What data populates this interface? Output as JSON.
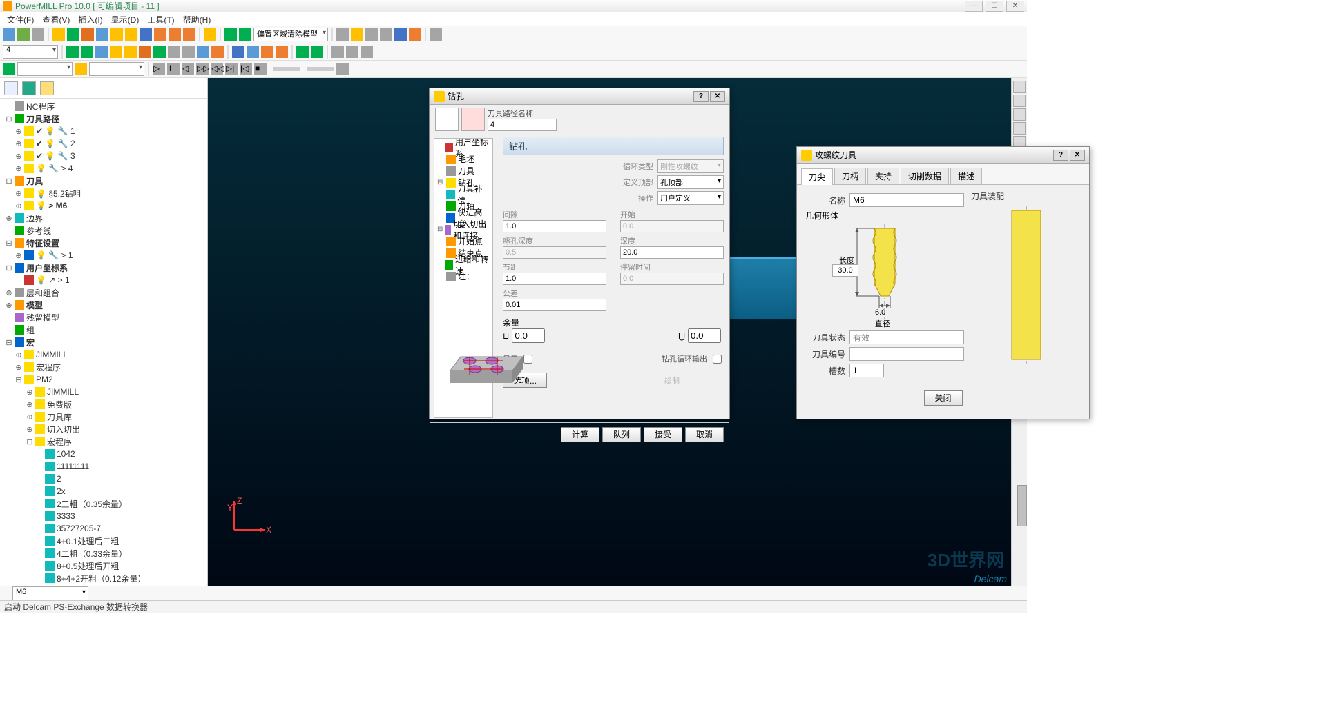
{
  "titlebar": {
    "title": "PowerMILL Pro 10.0     [ 可编辑项目 - 11 ]"
  },
  "menu": [
    "文件(F)",
    "查看(V)",
    "插入(I)",
    "显示(D)",
    "工具(T)",
    "帮助(H)"
  ],
  "toolbar1_combo": "偏置区域清除模型",
  "toolbar2_num": "4",
  "tree": {
    "items": [
      {
        "ind": 0,
        "exp": "",
        "icon": "ic-gray",
        "label": "NC程序"
      },
      {
        "ind": 0,
        "exp": "⊟",
        "icon": "ic-green",
        "label": "刀具路径",
        "bold": true
      },
      {
        "ind": 1,
        "exp": "⊕",
        "icon": "ic-yellow",
        "label": "1",
        "prefix": "✔ 💡 🔧 "
      },
      {
        "ind": 1,
        "exp": "⊕",
        "icon": "ic-yellow",
        "label": "2",
        "prefix": "✔ 💡 🔧 "
      },
      {
        "ind": 1,
        "exp": "⊕",
        "icon": "ic-yellow",
        "label": "3",
        "prefix": "✔ 💡 🔧 "
      },
      {
        "ind": 1,
        "exp": "⊕",
        "icon": "ic-yellow",
        "label": "> 4",
        "prefix": "  💡 🔧 "
      },
      {
        "ind": 0,
        "exp": "⊟",
        "icon": "ic-orange",
        "label": "刀具",
        "bold": true
      },
      {
        "ind": 1,
        "exp": "⊕",
        "icon": "ic-yellow",
        "label": "§5.2钻咀",
        "prefix": "  💡 "
      },
      {
        "ind": 1,
        "exp": "⊕",
        "icon": "ic-yellow",
        "label": "> M6",
        "prefix": "  💡 ",
        "bold": true
      },
      {
        "ind": 0,
        "exp": "⊕",
        "icon": "ic-teal",
        "label": "边界"
      },
      {
        "ind": 0,
        "exp": "",
        "icon": "ic-green",
        "label": "参考线"
      },
      {
        "ind": 0,
        "exp": "⊟",
        "icon": "ic-orange",
        "label": "特征设置",
        "bold": true
      },
      {
        "ind": 1,
        "exp": "⊕",
        "icon": "ic-blue",
        "label": "> 1",
        "prefix": "  💡 🔧 "
      },
      {
        "ind": 0,
        "exp": "⊟",
        "icon": "ic-blue",
        "label": "用户坐标系",
        "bold": true
      },
      {
        "ind": 1,
        "exp": "",
        "icon": "ic-red",
        "label": "> 1",
        "prefix": "  💡 ↗ "
      },
      {
        "ind": 0,
        "exp": "⊕",
        "icon": "ic-gray",
        "label": "层和组合"
      },
      {
        "ind": 0,
        "exp": "⊕",
        "icon": "ic-orange",
        "label": "模型",
        "bold": true
      },
      {
        "ind": 0,
        "exp": "",
        "icon": "ic-purple",
        "label": "残留模型"
      },
      {
        "ind": 0,
        "exp": "",
        "icon": "ic-green",
        "label": "组"
      },
      {
        "ind": 0,
        "exp": "⊟",
        "icon": "ic-blue",
        "label": "宏",
        "bold": true
      },
      {
        "ind": 1,
        "exp": "⊕",
        "icon": "ic-yellow",
        "label": "JIMMILL"
      },
      {
        "ind": 1,
        "exp": "⊕",
        "icon": "ic-yellow",
        "label": "宏程序"
      },
      {
        "ind": 1,
        "exp": "⊟",
        "icon": "ic-yellow",
        "label": "PM2"
      },
      {
        "ind": 2,
        "exp": "⊕",
        "icon": "ic-yellow",
        "label": "JIMMILL"
      },
      {
        "ind": 2,
        "exp": "⊕",
        "icon": "ic-yellow",
        "label": "免费版"
      },
      {
        "ind": 2,
        "exp": "⊕",
        "icon": "ic-yellow",
        "label": "刀具库"
      },
      {
        "ind": 2,
        "exp": "⊕",
        "icon": "ic-yellow",
        "label": "切入切出"
      },
      {
        "ind": 2,
        "exp": "⊟",
        "icon": "ic-yellow",
        "label": "宏程序"
      },
      {
        "ind": 3,
        "exp": "",
        "icon": "ic-teal",
        "label": "1042"
      },
      {
        "ind": 3,
        "exp": "",
        "icon": "ic-teal",
        "label": "11111111"
      },
      {
        "ind": 3,
        "exp": "",
        "icon": "ic-teal",
        "label": "2"
      },
      {
        "ind": 3,
        "exp": "",
        "icon": "ic-teal",
        "label": "2x"
      },
      {
        "ind": 3,
        "exp": "",
        "icon": "ic-teal",
        "label": "2三粗（0.35余量）"
      },
      {
        "ind": 3,
        "exp": "",
        "icon": "ic-teal",
        "label": "3333"
      },
      {
        "ind": 3,
        "exp": "",
        "icon": "ic-teal",
        "label": "35727205-7"
      },
      {
        "ind": 3,
        "exp": "",
        "icon": "ic-teal",
        "label": "4+0.1处理后二粗"
      },
      {
        "ind": 3,
        "exp": "",
        "icon": "ic-teal",
        "label": "4二粗（0.33余量）"
      },
      {
        "ind": 3,
        "exp": "",
        "icon": "ic-teal",
        "label": "8+0.5处理后开粗"
      },
      {
        "ind": 3,
        "exp": "",
        "icon": "ic-teal",
        "label": "8+4+2开粗（0.12余量）"
      }
    ]
  },
  "bottom_combo": "M6",
  "status": "启动 Delcam PS-Exchange 数据转换器",
  "delcam": "Delcam",
  "watermark": "3D世界网",
  "drill": {
    "title": "钻孔",
    "path_name_label": "刀具路径名称",
    "path_name_value": "4",
    "section_title": "钻孔",
    "tree": [
      "用户坐标系",
      "毛坯",
      "刀具",
      "钻孔",
      "刀具补偿",
      "刀轴",
      "快进高度",
      "切入切出和连接",
      "开始点",
      "结束点",
      "进给和转速",
      "注："
    ],
    "p": {
      "cycle_type_lbl": "循环类型",
      "cycle_type_val": "刚性攻螺纹",
      "def_top_lbl": "定义顶部",
      "def_top_val": "孔顶部",
      "op_lbl": "操作",
      "op_val": "用户定义",
      "gap_lbl": "间隙",
      "gap_val": "1.0",
      "start_lbl": "开始",
      "start_val": "0.0",
      "peck_lbl": "啄孔深度",
      "peck_val": "0.5",
      "depth_lbl": "深度",
      "depth_val": "20.0",
      "pitch_lbl": "节距",
      "pitch_val": "1.0",
      "dwell_lbl": "停留时间",
      "dwell_val": "0.0",
      "tol_lbl": "公差",
      "tol_val": "0.01",
      "allow_lbl": "余量",
      "allow_val": "0.0",
      "allow_val2": "0.0",
      "show_lbl": "显示",
      "cycle_out_lbl": "钻孔循环输出",
      "draw_lbl": "绘制",
      "options_btn": "选项..."
    },
    "footer": {
      "calc": "计算",
      "queue": "队列",
      "accept": "接受",
      "cancel": "取消"
    }
  },
  "tool": {
    "title": "攻螺纹刀具",
    "tabs": [
      "刀尖",
      "刀柄",
      "夹持",
      "切削数据",
      "描述"
    ],
    "name_lbl": "名称",
    "name_val": "M6",
    "geo_lbl": "几何形体",
    "len_lbl": "长度",
    "len_val": "30.0",
    "dia_lbl": "直径",
    "dia_val": "6.0",
    "state_lbl": "刀具状态",
    "state_val": "有效",
    "id_lbl": "刀具编号",
    "id_val": "",
    "flute_lbl": "槽数",
    "flute_val": "1",
    "assy_lbl": "刀具装配",
    "close": "关闭"
  }
}
